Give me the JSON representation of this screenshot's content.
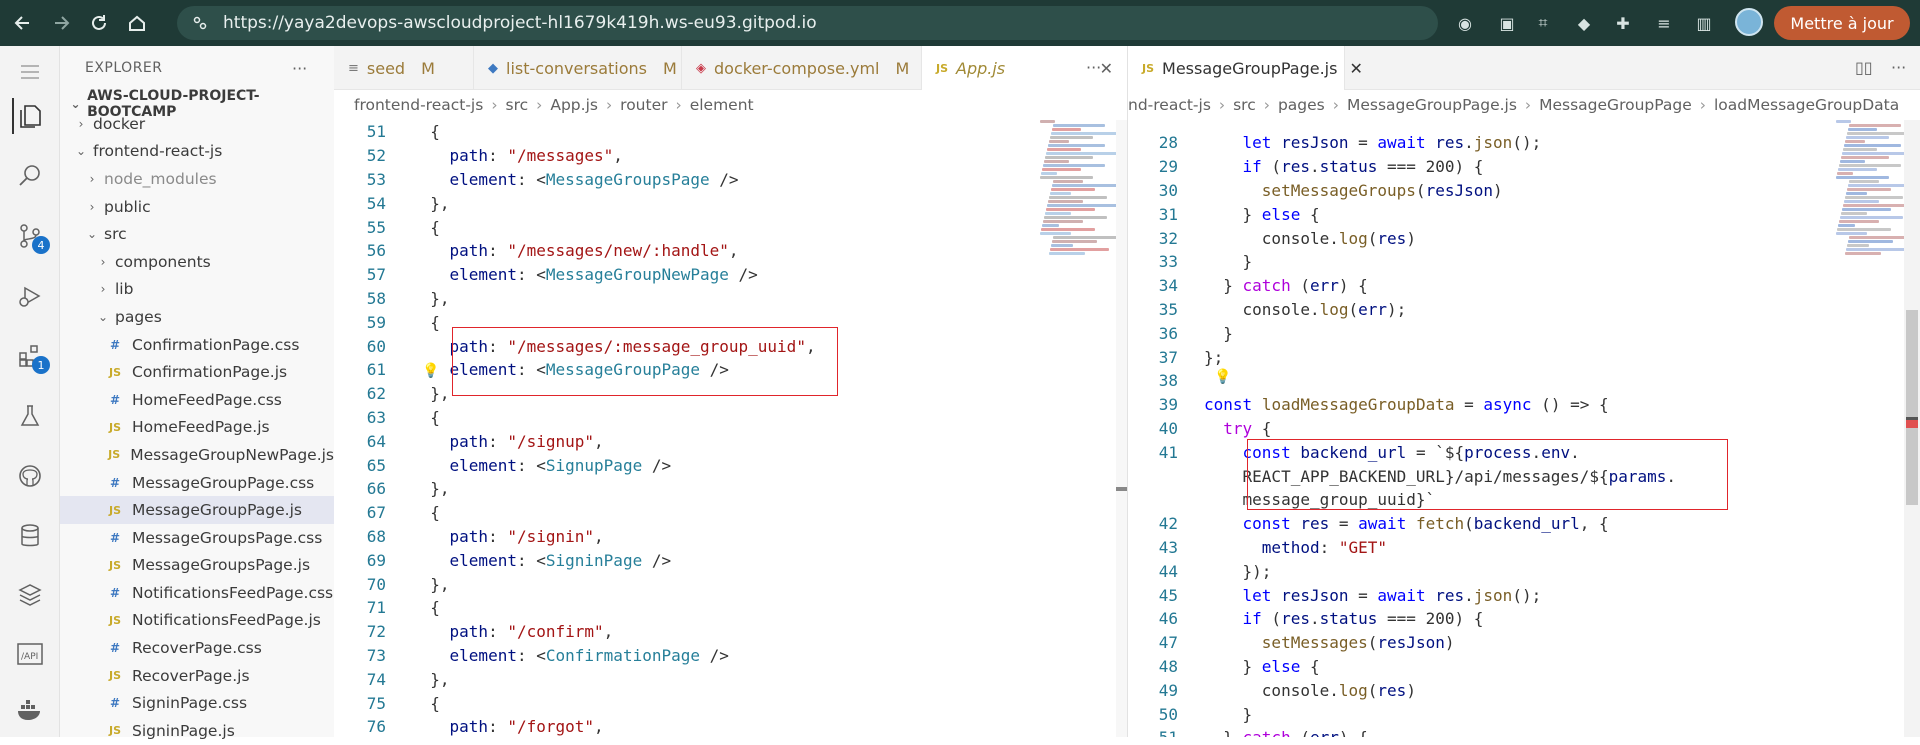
{
  "browser": {
    "url": "https://yaya2devops-awscloudproject-hl1679k419h.ws-eu93.gitpod.io",
    "update_button": "Mettre à jour",
    "accent": "#1f3a36"
  },
  "activity_bar": {
    "scm_badge": "4",
    "extensions_badge": "1"
  },
  "explorer": {
    "title": "EXPLORER",
    "project": "AWS-CLOUD-PROJECT-BOOTCAMP",
    "items": [
      {
        "label": "docker",
        "kind": "folder",
        "indent": 1,
        "open": false
      },
      {
        "label": "frontend-react-js",
        "kind": "folder",
        "indent": 1,
        "open": true
      },
      {
        "label": "node_modules",
        "kind": "folder",
        "indent": 2,
        "open": false,
        "muted": true
      },
      {
        "label": "public",
        "kind": "folder",
        "indent": 2,
        "open": false
      },
      {
        "label": "src",
        "kind": "folder",
        "indent": 2,
        "open": true
      },
      {
        "label": "components",
        "kind": "folder",
        "indent": 3,
        "open": false
      },
      {
        "label": "lib",
        "kind": "folder",
        "indent": 3,
        "open": false
      },
      {
        "label": "pages",
        "kind": "folder",
        "indent": 3,
        "open": true
      },
      {
        "label": "ConfirmationPage.css",
        "kind": "css",
        "indent": 4
      },
      {
        "label": "ConfirmationPage.js",
        "kind": "js",
        "indent": 4
      },
      {
        "label": "HomeFeedPage.css",
        "kind": "css",
        "indent": 4
      },
      {
        "label": "HomeFeedPage.js",
        "kind": "js",
        "indent": 4
      },
      {
        "label": "MessageGroupNewPage.js",
        "kind": "js",
        "indent": 4
      },
      {
        "label": "MessageGroupPage.css",
        "kind": "css",
        "indent": 4
      },
      {
        "label": "MessageGroupPage.js",
        "kind": "js",
        "indent": 4,
        "selected": true
      },
      {
        "label": "MessageGroupsPage.css",
        "kind": "css",
        "indent": 4
      },
      {
        "label": "MessageGroupsPage.js",
        "kind": "js",
        "indent": 4
      },
      {
        "label": "NotificationsFeedPage.css",
        "kind": "css",
        "indent": 4
      },
      {
        "label": "NotificationsFeedPage.js",
        "kind": "js",
        "indent": 4
      },
      {
        "label": "RecoverPage.css",
        "kind": "css",
        "indent": 4
      },
      {
        "label": "RecoverPage.js",
        "kind": "js",
        "indent": 4
      },
      {
        "label": "SigninPage.css",
        "kind": "css",
        "indent": 4
      },
      {
        "label": "SigninPage.js",
        "kind": "js",
        "indent": 4
      }
    ]
  },
  "left_editor": {
    "tabs": [
      {
        "label": "seed",
        "mark": "M",
        "icon": "≡"
      },
      {
        "label": "list-conversations",
        "mark": "M",
        "icon": "◆"
      },
      {
        "label": "docker-compose.yml",
        "mark": "M",
        "icon": "◈"
      },
      {
        "label": "App.js",
        "mark": "",
        "icon": "JS",
        "active": true
      }
    ],
    "breadcrumb": [
      "frontend-react-js",
      "src",
      "App.js",
      "router",
      "element"
    ],
    "lines": [
      {
        "n": "51",
        "code": "  {"
      },
      {
        "n": "52",
        "code": "    path: \"/messages\","
      },
      {
        "n": "53",
        "code": "    element: <MessageGroupsPage />"
      },
      {
        "n": "54",
        "code": "  },"
      },
      {
        "n": "55",
        "code": "  {"
      },
      {
        "n": "56",
        "code": "    path: \"/messages/new/:handle\","
      },
      {
        "n": "57",
        "code": "    element: <MessageGroupNewPage />"
      },
      {
        "n": "58",
        "code": "  },"
      },
      {
        "n": "59",
        "code": "  {"
      },
      {
        "n": "60",
        "code": "    path: \"/messages/:message_group_uuid\","
      },
      {
        "n": "61",
        "code": "    element: <MessageGroupPage />"
      },
      {
        "n": "62",
        "code": "  },"
      },
      {
        "n": "63",
        "code": "  {"
      },
      {
        "n": "64",
        "code": "    path: \"/signup\","
      },
      {
        "n": "65",
        "code": "    element: <SignupPage />"
      },
      {
        "n": "66",
        "code": "  },"
      },
      {
        "n": "67",
        "code": "  {"
      },
      {
        "n": "68",
        "code": "    path: \"/signin\","
      },
      {
        "n": "69",
        "code": "    element: <SigninPage />"
      },
      {
        "n": "70",
        "code": "  },"
      },
      {
        "n": "71",
        "code": "  {"
      },
      {
        "n": "72",
        "code": "    path: \"/confirm\","
      },
      {
        "n": "73",
        "code": "    element: <ConfirmationPage />"
      },
      {
        "n": "74",
        "code": "  },"
      },
      {
        "n": "75",
        "code": "  {"
      },
      {
        "n": "76",
        "code": "    path: \"/forgot\","
      }
    ]
  },
  "right_editor": {
    "tab": {
      "label": "MessageGroupPage.js",
      "icon": "JS"
    },
    "breadcrumb": [
      "nd-react-js",
      "src",
      "pages",
      "MessageGroupPage.js",
      "MessageGroupPage",
      "loadMessageGroupData"
    ],
    "lines": [
      {
        "n": "28",
        "code": "    let resJson = await res.json();"
      },
      {
        "n": "29",
        "code": "    if (res.status === 200) {"
      },
      {
        "n": "30",
        "code": "      setMessageGroups(resJson)"
      },
      {
        "n": "31",
        "code": "    } else {"
      },
      {
        "n": "32",
        "code": "      console.log(res)"
      },
      {
        "n": "33",
        "code": "    }"
      },
      {
        "n": "34",
        "code": "  } catch (err) {"
      },
      {
        "n": "35",
        "code": "    console.log(err);"
      },
      {
        "n": "36",
        "code": "  }"
      },
      {
        "n": "37",
        "code": "};"
      },
      {
        "n": "38",
        "code": ""
      },
      {
        "n": "39",
        "code": "const loadMessageGroupData = async () => {"
      },
      {
        "n": "40",
        "code": "  try {"
      },
      {
        "n": "41",
        "code": "    const backend_url = `${process.env."
      },
      {
        "n": "",
        "code": "    REACT_APP_BACKEND_URL}/api/messages/${params."
      },
      {
        "n": "",
        "code": "    message_group_uuid}`"
      },
      {
        "n": "42",
        "code": "    const res = await fetch(backend_url, {"
      },
      {
        "n": "43",
        "code": "      method: \"GET\""
      },
      {
        "n": "44",
        "code": "    });"
      },
      {
        "n": "45",
        "code": "    let resJson = await res.json();"
      },
      {
        "n": "46",
        "code": "    if (res.status === 200) {"
      },
      {
        "n": "47",
        "code": "      setMessages(resJson)"
      },
      {
        "n": "48",
        "code": "    } else {"
      },
      {
        "n": "49",
        "code": "      console.log(res)"
      },
      {
        "n": "50",
        "code": "    }"
      },
      {
        "n": "51",
        "code": "  } catch (err) {"
      }
    ]
  }
}
